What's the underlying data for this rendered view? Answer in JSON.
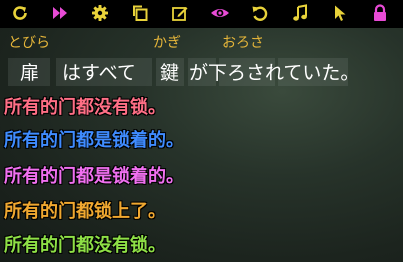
{
  "toolbar": {
    "icons": [
      {
        "name": "replay-icon",
        "color": "#e8d23a"
      },
      {
        "name": "fast-forward-icon",
        "color": "#e84bd6"
      },
      {
        "name": "settings-gear-icon",
        "color": "#e8d23a"
      },
      {
        "name": "copy-icon",
        "color": "#e8d23a"
      },
      {
        "name": "edit-icon",
        "color": "#e8d23a"
      },
      {
        "name": "eye-icon",
        "color": "#e84bd6"
      },
      {
        "name": "undo-icon",
        "color": "#e8d23a"
      },
      {
        "name": "music-note-icon",
        "color": "#e8d23a"
      },
      {
        "name": "cursor-icon",
        "color": "#e8d23a"
      },
      {
        "name": "lock-icon",
        "color": "#e84bd6"
      }
    ]
  },
  "sentence": {
    "furigana_1": "とびら",
    "furigana_2": "かぎ",
    "furigana_3": "おろさ",
    "kanji_1": "扉",
    "seg_2": "はすべて",
    "kanji_2": "鍵",
    "seg_4": "が下ろされていた。"
  },
  "translations": [
    {
      "text": "所有的门都没有锁。",
      "color": "#ff6f86"
    },
    {
      "text": "所有的门都是锁着的。",
      "color": "#3f8cff"
    },
    {
      "text": "所有的门都是锁着的。",
      "color": "#f070f0"
    },
    {
      "text": "所有的门都锁上了。",
      "color": "#f0a830"
    },
    {
      "text": "所有的门都没有锁。",
      "color": "#8ee046"
    }
  ]
}
